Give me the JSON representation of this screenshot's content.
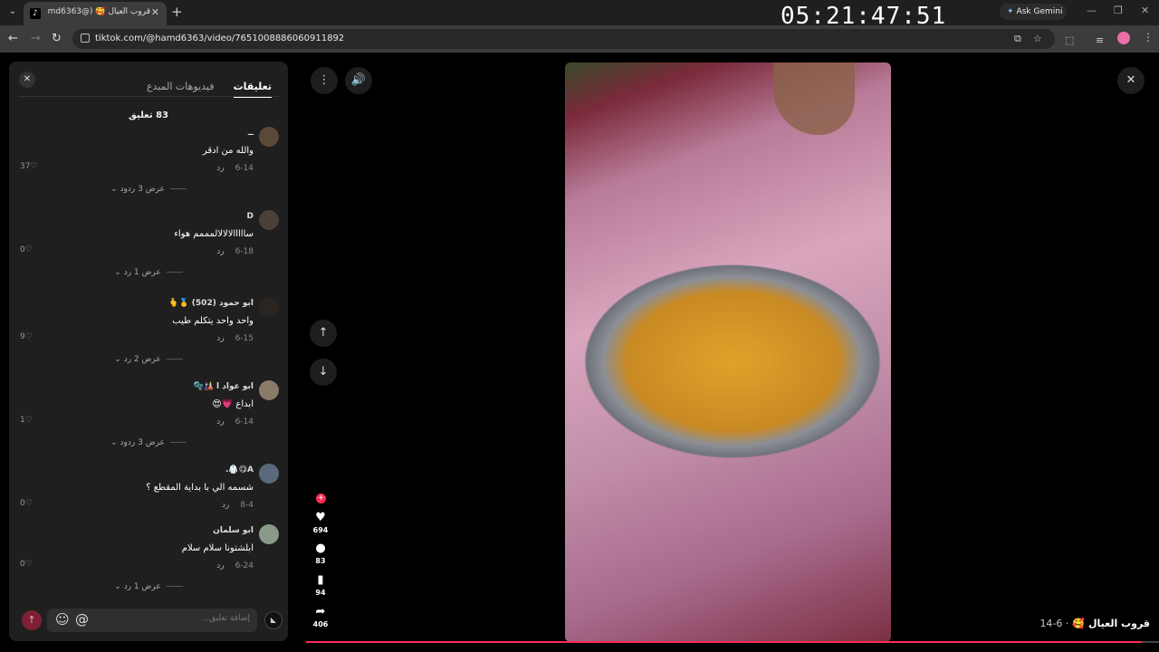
{
  "browser": {
    "tab_title": "قروب العيال 🥰 (@hamd6363) |",
    "tab_favicon": "tiktok-icon",
    "clock": "05:21:47:51",
    "gemini_label": "Ask Gemini",
    "url": "tiktok.com/@hamd6363/video/7651008886060911892"
  },
  "panel": {
    "tabs": [
      {
        "label": "تعليقات",
        "active": true
      },
      {
        "label": "فيديوهات المبدع",
        "active": false
      }
    ],
    "count": "83 تعليق",
    "reply_label": "رد",
    "comments": [
      {
        "name": "ــ",
        "text": "والله من ادقر",
        "date": "6-14",
        "likes": "37",
        "replies": "عرض 3 ردود"
      },
      {
        "name": "D",
        "text": "سااااالالالالمممم هواء",
        "date": "6-18",
        "likes": "0",
        "replies": "عرض 1 رد"
      },
      {
        "name": "ابو حمود (502) 🥇🫰",
        "text": "واحد واحد يتكلم طيب",
        "date": "6-15",
        "likes": "9",
        "replies": "عرض 2 رد"
      },
      {
        "name": "ابو عواد ا 🎎🫧",
        "text": "ابداع 💗😍",
        "date": "6-14",
        "likes": "1",
        "replies": "عرض 3 ردود"
      },
      {
        "name": "A😋🥼.",
        "text": "شسمه الي با بداية المقطع ؟",
        "date": "8-4",
        "likes": "0",
        "replies": ""
      },
      {
        "name": "ابو سلمان",
        "text": "ابلشتونا سلام سلام",
        "date": "6-24",
        "likes": "0",
        "replies": "عرض 1 رد"
      }
    ],
    "composer_placeholder": "إضافة تعليق..."
  },
  "video": {
    "actions": [
      {
        "icon": "heart-icon",
        "count": "694"
      },
      {
        "icon": "comment-icon",
        "count": "83"
      },
      {
        "icon": "bookmark-icon",
        "count": "94"
      },
      {
        "icon": "share-icon",
        "count": "406"
      }
    ],
    "caption_author": "قروب العيال 🥰",
    "caption_date": "· 6-14",
    "progress": 0.98,
    "accent": "#fe2c55"
  }
}
